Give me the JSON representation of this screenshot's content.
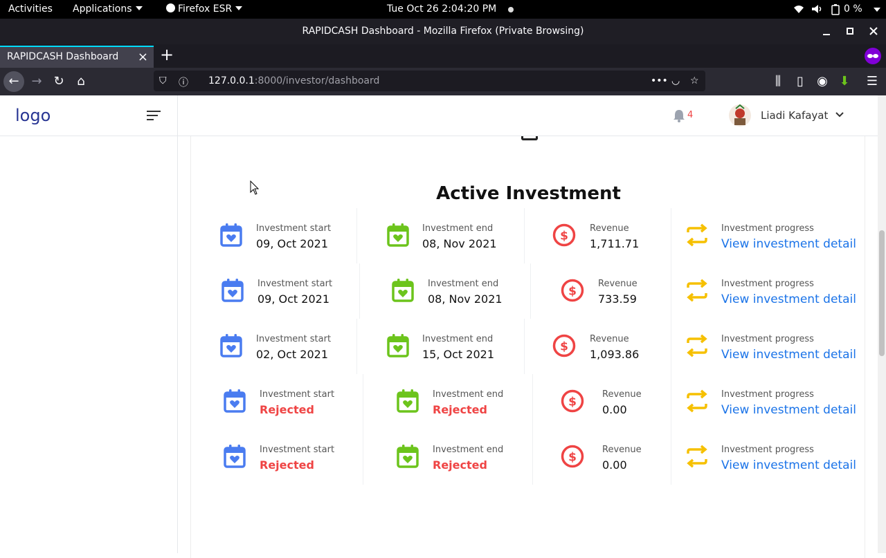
{
  "system_bar": {
    "activities": "Activities",
    "applications": "Applications",
    "firefox": "Firefox ESR",
    "datetime": "Tue Oct 26  2:04:20 PM",
    "battery": "0 %"
  },
  "window": {
    "title": "RAPIDCASH Dashboard - Mozilla Firefox (Private Browsing)"
  },
  "tab": {
    "label": "RAPIDCASH Dashboard"
  },
  "urlbar": {
    "host": "127.0.0.1",
    "rest": ":8000/investor/dashboard"
  },
  "sidebar": {
    "logo": "logo"
  },
  "header": {
    "notifications": "4",
    "user_name": "Liadi Kafayat"
  },
  "main": {
    "title": "Active Investment",
    "investments": [
      {
        "start_label": "Investment start",
        "start": "09, Oct 2021",
        "end_label": "Investment end",
        "end": "08, Nov 2021",
        "revenue_label": "Revenue",
        "revenue": "1,711.71",
        "progress_label": "Investment progress",
        "link": "View investment detail",
        "status": "ok"
      },
      {
        "start_label": "Investment start",
        "start": "09, Oct 2021",
        "end_label": "Investment end",
        "end": "08, Nov 2021",
        "revenue_label": "Revenue",
        "revenue": "733.59",
        "progress_label": "Investment progress",
        "link": "View investment detail",
        "status": "ok"
      },
      {
        "start_label": "Investment start",
        "start": "02, Oct 2021",
        "end_label": "Investment end",
        "end": "15, Oct 2021",
        "revenue_label": "Revenue",
        "revenue": "1,093.86",
        "progress_label": "Investment progress",
        "link": "View investment detail",
        "status": "ok"
      },
      {
        "start_label": "Investment start",
        "start": "Rejected",
        "end_label": "Investment end",
        "end": "Rejected",
        "revenue_label": "Revenue",
        "revenue": "0.00",
        "progress_label": "Investment progress",
        "link": "View investment detail",
        "status": "rejected"
      },
      {
        "start_label": "Investment start",
        "start": "Rejected",
        "end_label": "Investment end",
        "end": "Rejected",
        "revenue_label": "Revenue",
        "revenue": "0.00",
        "progress_label": "Investment progress",
        "link": "View investment detail",
        "status": "rejected"
      }
    ]
  },
  "colors": {
    "start_icon": "#4a7cf0",
    "end_icon": "#6cc41c",
    "revenue_icon": "#ef4444",
    "progress_icon": "#f6c000",
    "link": "#1a73e8",
    "rejected": "#ef4444"
  }
}
